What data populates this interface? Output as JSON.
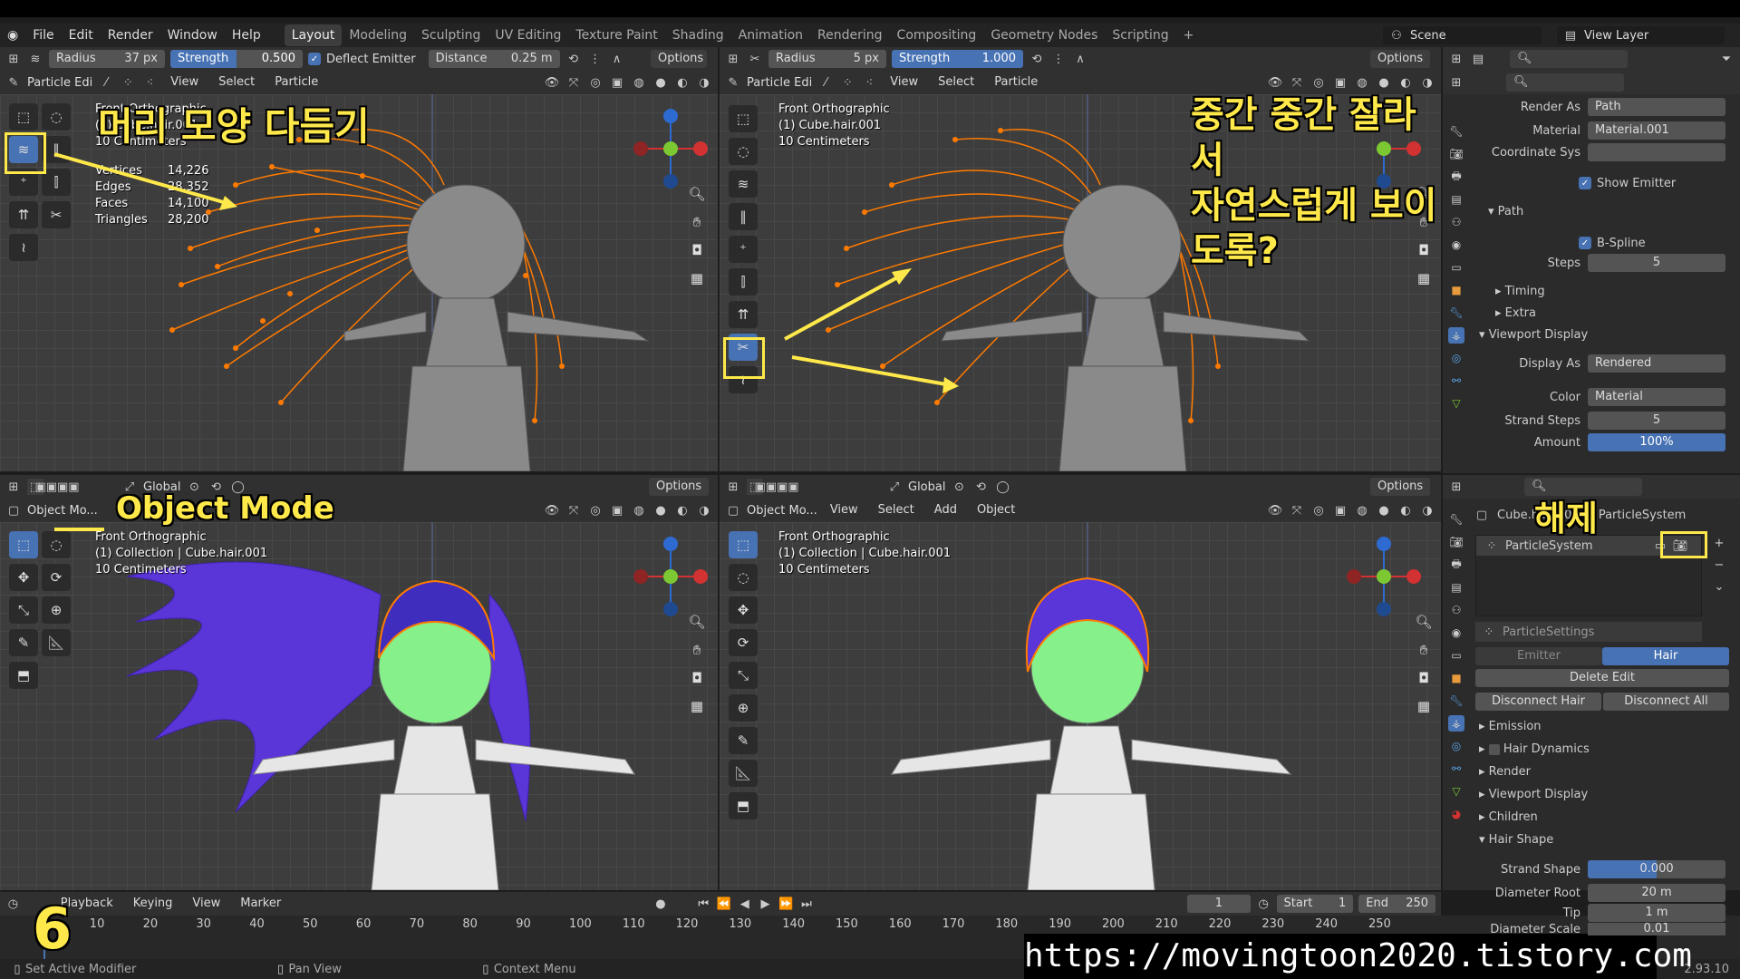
{
  "menubar": {
    "items": [
      "File",
      "Edit",
      "Render",
      "Window",
      "Help"
    ],
    "workspaces": [
      "Layout",
      "Modeling",
      "Sculpting",
      "UV Editing",
      "Texture Paint",
      "Shading",
      "Animation",
      "Rendering",
      "Compositing",
      "Geometry Nodes",
      "Scripting"
    ],
    "add_tab": "+",
    "scene_label": "Scene",
    "view_layer_label": "View Layer"
  },
  "vp_tl": {
    "radius_label": "Radius",
    "radius_value": "37 px",
    "strength_label": "Strength",
    "strength_value": "0.500",
    "deflect": "Deflect Emitter",
    "distance_label": "Distance",
    "distance_value": "0.25 m",
    "options": "Options",
    "mode": "Particle Edi",
    "view": "View",
    "select": "Select",
    "particle": "Particle",
    "info": {
      "line1": "Front Orthographic",
      "line2": "(1) Cube.hair.001",
      "line3": "10 Centimeters"
    },
    "stats": [
      {
        "k": "Vertices",
        "v": "14,226"
      },
      {
        "k": "Edges",
        "v": "28,352"
      },
      {
        "k": "Faces",
        "v": "14,100"
      },
      {
        "k": "Triangles",
        "v": "28,200"
      }
    ]
  },
  "vp_tr": {
    "radius_label": "Radius",
    "radius_value": "5 px",
    "strength_label": "Strength",
    "strength_value": "1.000",
    "options": "Options",
    "mode": "Particle Edi",
    "view": "View",
    "select": "Select",
    "particle": "Particle",
    "info": {
      "line1": "Front Orthographic",
      "line2": "(1) Cube.hair.001",
      "line3": "10 Centimeters"
    }
  },
  "vp_bl": {
    "mode": "Object Mo...",
    "orientation": "Global",
    "options": "Options",
    "info": {
      "line1": "Front Orthographic",
      "line2": "(1) Collection | Cube.hair.001",
      "line3": "10 Centimeters"
    }
  },
  "vp_br": {
    "mode": "Object Mo...",
    "view": "View",
    "select": "Select",
    "add": "Add",
    "object": "Object",
    "orientation": "Global",
    "options": "Options",
    "info": {
      "line1": "Front Orthographic",
      "line2": "(1) Collection | Cube.hair.001",
      "line3": "10 Centimeters"
    }
  },
  "annotations": {
    "comb": "머리 모양 다듬기",
    "cut_line1": "중간 중간 잘라서",
    "cut_line2": "자연스럽게 보이도록?",
    "object_mode": "Object Mode",
    "release": "해제",
    "step": "6",
    "url": "https://movingtoon2020.tistory.com"
  },
  "props_top": {
    "render_as_label": "Render As",
    "render_as": "Path",
    "material_label": "Material",
    "material": "Material.001",
    "coord_label": "Coordinate Sys",
    "show_emitter": "Show Emitter",
    "path": "Path",
    "bspline": "B-Spline",
    "steps_label": "Steps",
    "steps": "5",
    "timing": "Timing",
    "extra": "Extra",
    "viewport_display": "Viewport Display",
    "display_as_label": "Display As",
    "display_as": "Rendered",
    "color_label": "Color",
    "color": "Material",
    "strand_steps_label": "Strand Steps",
    "strand_steps": "5",
    "amount_label": "Amount",
    "amount": "100%",
    "amount_fraction": 1.0
  },
  "props_bottom": {
    "object": "Cube.hair.001",
    "system_tab": "ParticleSystem",
    "system_item": "ParticleSystem",
    "settings": "ParticleSettings",
    "emitter": "Emitter",
    "hair": "Hair",
    "delete_edit": "Delete Edit",
    "disconnect_hair": "Disconnect Hair",
    "disconnect_all": "Disconnect All",
    "emission": "Emission",
    "hair_dynamics": "Hair Dynamics",
    "render": "Render",
    "viewport_display": "Viewport Display",
    "children": "Children",
    "hair_shape": "Hair Shape",
    "strand_shape_label": "Strand Shape",
    "strand_shape": "0.000",
    "diameter_root_label": "Diameter Root",
    "diameter_root": "20 m",
    "tip_label": "Tip",
    "tip": "1 m",
    "diameter_scale_label": "Diameter Scale",
    "diameter_scale": "0.01"
  },
  "timeline": {
    "playback": "Playback",
    "keying": "Keying",
    "view": "View",
    "marker": "Marker",
    "current": "1",
    "start_label": "Start",
    "start": "1",
    "end_label": "End",
    "end": "250",
    "ticks": [
      "0",
      "10",
      "20",
      "30",
      "40",
      "50",
      "60",
      "70",
      "80",
      "90",
      "100",
      "110",
      "120",
      "130",
      "140",
      "150",
      "160",
      "170",
      "180",
      "190",
      "200",
      "210",
      "220",
      "230",
      "240",
      "250"
    ]
  },
  "status": {
    "left": "Set Active Modifier",
    "mid": "Pan View",
    "right": "Context Menu",
    "version": "2.93.10"
  },
  "colors": {
    "accent": "#4772b3",
    "hair_orange": "#ff7a00",
    "hair_purple": "#5a35d8",
    "face_green": "#86f08a",
    "annotation": "#ffe94a"
  }
}
